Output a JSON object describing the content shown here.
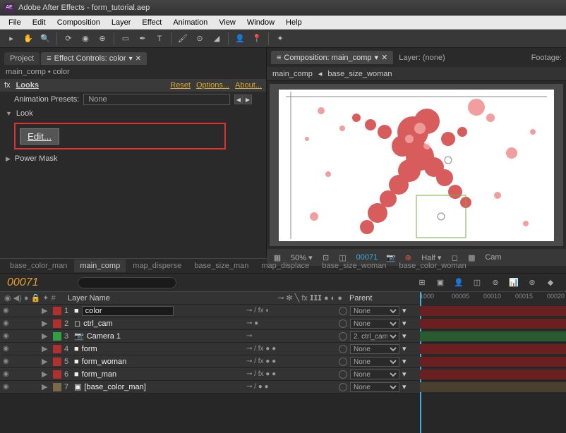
{
  "title": "Adobe After Effects - form_tutorial.aep",
  "menu": [
    "File",
    "Edit",
    "Composition",
    "Layer",
    "Effect",
    "Animation",
    "View",
    "Window",
    "Help"
  ],
  "left_panel": {
    "tabs": [
      {
        "label": "Project"
      },
      {
        "label": "Effect Controls: color",
        "active": true
      }
    ],
    "breadcrumb": "main_comp • color",
    "fx_prefix": "fx",
    "effect_name": "Looks",
    "reset": "Reset",
    "options": "Options...",
    "about": "About...",
    "presets_label": "Animation Presets:",
    "presets_value": "None",
    "look_label": "Look",
    "edit_label": "Edit...",
    "power_mask": "Power Mask"
  },
  "right_panel": {
    "comp_tab": "Composition: main_comp",
    "layer_tab": "Layer: (none)",
    "footage_tab": "Footage:",
    "crumb1": "main_comp",
    "crumb2": "base_size_woman",
    "zoom": "50%",
    "timecode": "00071",
    "res": "Half",
    "cam": "Cam"
  },
  "timeline": {
    "tabs": [
      "base_color_man",
      "main_comp",
      "map_disperse",
      "base_size_man",
      "map_displace",
      "base_size_woman",
      "base_color_woman"
    ],
    "active_tab": 1,
    "time": "00071",
    "col_layer_name": "Layer Name",
    "col_parent": "Parent",
    "switches_header": "⊸ ✻ ╲ fx 𝗜𝗜𝗜 ● ◐ ●",
    "ruler": [
      "1000",
      "00005",
      "00010",
      "00015",
      "00020"
    ],
    "layers": [
      {
        "num": "1",
        "color": "#b03030",
        "name": "color",
        "editable": true,
        "icon": "solid",
        "switches": "⊸    / fx          ◐",
        "parent": "None",
        "bar": "#6a2020"
      },
      {
        "num": "2",
        "color": "#b03030",
        "name": "ctrl_cam",
        "icon": "null",
        "switches": "⊸                  ●",
        "parent": "None",
        "bar": "#6a2020"
      },
      {
        "num": "3",
        "color": "#30a040",
        "name": "Camera 1",
        "icon": "camera",
        "switches": "⊸",
        "parent": "2. ctrl_cam",
        "bar": "#2a5a30"
      },
      {
        "num": "4",
        "color": "#b03030",
        "name": "form",
        "icon": "solid",
        "switches": "⊸    / fx      ●   ●",
        "parent": "None",
        "bar": "#6a2020"
      },
      {
        "num": "5",
        "color": "#b03030",
        "name": "form_woman",
        "icon": "solid",
        "switches": "⊸    / fx      ●   ●",
        "parent": "None",
        "bar": "#6a2020"
      },
      {
        "num": "6",
        "color": "#b03030",
        "name": "form_man",
        "icon": "solid",
        "switches": "⊸    / fx      ●   ●",
        "parent": "None",
        "bar": "#6a2020"
      },
      {
        "num": "7",
        "color": "#7a6a4a",
        "name": "[base_color_man]",
        "icon": "comp",
        "switches": "⊸    /        ●   ●",
        "parent": "None",
        "bar": "#4a4030"
      }
    ]
  }
}
